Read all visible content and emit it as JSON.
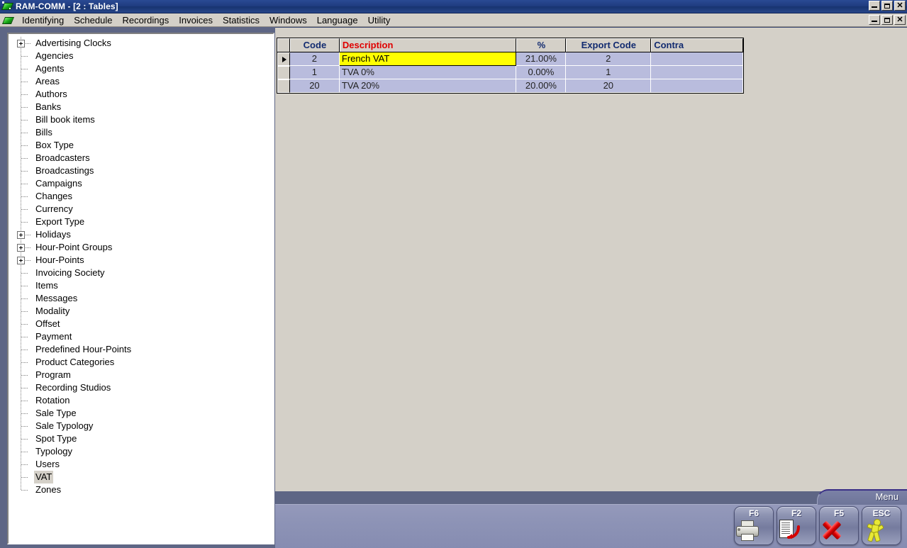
{
  "window": {
    "title": "RAM-COMM - [2 : Tables]",
    "app_icon": "green-gem-icon",
    "buttons": {
      "minimize": "minimize-icon",
      "restore": "restore-icon",
      "close": "close-icon"
    }
  },
  "menubar": {
    "icon": "green-gem-icon",
    "items": [
      {
        "label": "Identifying"
      },
      {
        "label": "Schedule"
      },
      {
        "label": "Recordings"
      },
      {
        "label": "Invoices"
      },
      {
        "label": "Statistics"
      },
      {
        "label": "Windows"
      },
      {
        "label": "Language"
      },
      {
        "label": "Utility"
      }
    ]
  },
  "tree": {
    "selected": "VAT",
    "items": [
      {
        "label": "Advertising Clocks",
        "expandable": true
      },
      {
        "label": "Agencies",
        "expandable": false
      },
      {
        "label": "Agents",
        "expandable": false
      },
      {
        "label": "Areas",
        "expandable": false
      },
      {
        "label": "Authors",
        "expandable": false
      },
      {
        "label": "Banks",
        "expandable": false
      },
      {
        "label": "Bill book items",
        "expandable": false
      },
      {
        "label": "Bills",
        "expandable": false
      },
      {
        "label": "Box Type",
        "expandable": false
      },
      {
        "label": "Broadcasters",
        "expandable": false
      },
      {
        "label": "Broadcastings",
        "expandable": false
      },
      {
        "label": "Campaigns",
        "expandable": false
      },
      {
        "label": "Changes",
        "expandable": false
      },
      {
        "label": "Currency",
        "expandable": false
      },
      {
        "label": "Export Type",
        "expandable": false
      },
      {
        "label": "Holidays",
        "expandable": true
      },
      {
        "label": "Hour-Point Groups",
        "expandable": true
      },
      {
        "label": "Hour-Points",
        "expandable": true
      },
      {
        "label": "Invoicing Society",
        "expandable": false
      },
      {
        "label": "Items",
        "expandable": false
      },
      {
        "label": "Messages",
        "expandable": false
      },
      {
        "label": "Modality",
        "expandable": false
      },
      {
        "label": "Offset",
        "expandable": false
      },
      {
        "label": "Payment",
        "expandable": false
      },
      {
        "label": "Predefined Hour-Points",
        "expandable": false
      },
      {
        "label": "Product Categories",
        "expandable": false
      },
      {
        "label": "Program",
        "expandable": false
      },
      {
        "label": "Recording Studios",
        "expandable": false
      },
      {
        "label": "Rotation",
        "expandable": false
      },
      {
        "label": "Sale Type",
        "expandable": false
      },
      {
        "label": "Sale Typology",
        "expandable": false
      },
      {
        "label": "Spot Type",
        "expandable": false
      },
      {
        "label": "Typology",
        "expandable": false
      },
      {
        "label": "Users",
        "expandable": false
      },
      {
        "label": "VAT",
        "expandable": false
      },
      {
        "label": "Zones",
        "expandable": false
      }
    ]
  },
  "grid": {
    "columns": [
      {
        "label": "Code",
        "align": "center",
        "color": "#122b70"
      },
      {
        "label": "Description",
        "align": "left",
        "color": "#e00000"
      },
      {
        "label": "%",
        "align": "center",
        "color": "#122b70"
      },
      {
        "label": "Export Code",
        "align": "center",
        "color": "#122b70"
      },
      {
        "label": "Contra",
        "align": "left",
        "color": "#122b70"
      }
    ],
    "rows": [
      {
        "current": true,
        "code": "2",
        "description": "French VAT",
        "description_editing": true,
        "percent": "21.00%",
        "export_code": "2",
        "contra": ""
      },
      {
        "current": false,
        "code": "1",
        "description": "TVA 0%",
        "description_editing": false,
        "percent": "0.00%",
        "export_code": "1",
        "contra": ""
      },
      {
        "current": false,
        "code": "20",
        "description": "TVA 20%",
        "description_editing": false,
        "percent": "20.00%",
        "export_code": "20",
        "contra": ""
      }
    ]
  },
  "bottom": {
    "menu_tab_label": "Menu",
    "fkeys": [
      {
        "key": "F6",
        "icon": "printer-icon"
      },
      {
        "key": "F2",
        "icon": "document-revert-icon"
      },
      {
        "key": "F5",
        "icon": "red-x-delete-icon"
      },
      {
        "key": "ESC",
        "icon": "exit-running-man-icon"
      }
    ]
  },
  "colors": {
    "titlebar": "#1f3c80",
    "app_background": "#5e6685",
    "panel_face": "#d4d0c8",
    "grid_row": "#b9bcdd",
    "editing_cell": "#ffff00",
    "header_text": "#122b70",
    "description_header_text": "#e00000"
  }
}
